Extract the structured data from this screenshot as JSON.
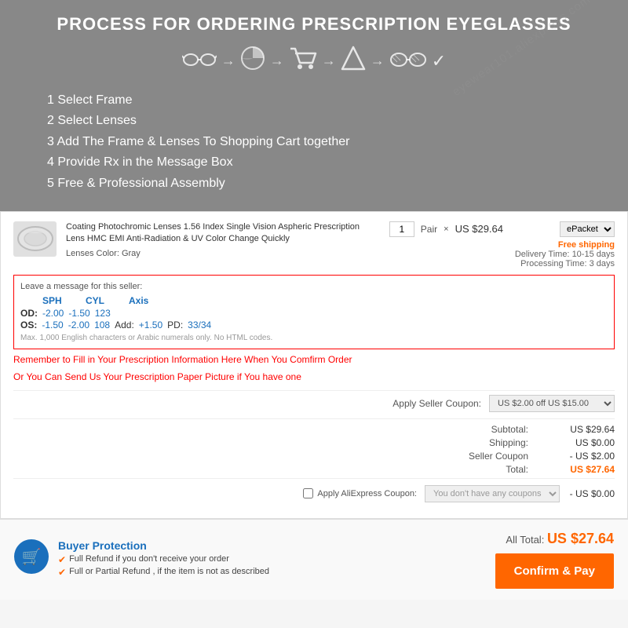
{
  "header": {
    "title": "PROCESS FOR ORDERING PRESCRIPTION EYEGLASSES",
    "watermark": "eyewear101.aliexpress.com"
  },
  "process_icons": {
    "icons": [
      "glasses",
      "lens",
      "cart",
      "warning",
      "rx-glasses"
    ],
    "checkmark": "✓"
  },
  "steps": [
    {
      "number": "1",
      "text": "Select Frame"
    },
    {
      "number": "2",
      "text": "Select Lenses"
    },
    {
      "number": "3",
      "text": "Add The Frame & Lenses To Shopping Cart together"
    },
    {
      "number": "4",
      "text": "Provide Rx in the Message Box"
    },
    {
      "number": "5",
      "text": "Free & Professional Assembly"
    }
  ],
  "product": {
    "title": "Coating Photochromic Lenses 1.56 Index Single Vision Aspheric Prescription Lens HMC EMI Anti-Radiation & UV Color Change Quickly",
    "color_label": "Lenses Color:",
    "color_value": "Gray",
    "quantity": "1",
    "unit": "Pair",
    "unit_price": "US $29.64",
    "shipping_method": "ePacket",
    "free_shipping": "Free shipping",
    "delivery_label": "Delivery Time:",
    "delivery_time": "10-15 days",
    "processing_label": "Processing Time:",
    "processing_time": "3 days"
  },
  "message_box": {
    "label": "Leave a message for this seller:",
    "headers": {
      "sph": "SPH",
      "cyl": "CYL",
      "axis": "Axis"
    },
    "od_row": {
      "eye": "OD:",
      "sph": "-2.00",
      "cyl": "-1.50",
      "axis": "123"
    },
    "os_row": {
      "eye": "OS:",
      "sph": "-1.50",
      "cyl": "-2.00",
      "axis": "108",
      "add_label": "Add:",
      "add_value": "+1.50",
      "pd_label": "PD:",
      "pd_value": "33/34"
    },
    "limit_text": "Max. 1,000 English characters or Arabic numerals only. No HTML codes.",
    "reminder": "Remember to Fill in Your Prescription Information Here When You Comfirm Order",
    "alternative": "Or You Can Send Us Your Prescription Paper Picture if You have one"
  },
  "coupon": {
    "label": "Apply Seller Coupon:",
    "placeholder": "US $2.00 off US $15.00",
    "icon": "▼"
  },
  "totals": {
    "subtotal_label": "Subtotal:",
    "subtotal_value": "US $29.64",
    "shipping_label": "Shipping:",
    "shipping_value": "US $0.00",
    "seller_coupon_label": "Seller Coupon",
    "seller_coupon_value": "- US $2.00",
    "total_label": "Total:",
    "total_value": "US $27.64"
  },
  "aliexpress_coupon": {
    "checkbox_label": "Apply AliExpress Coupon:",
    "placeholder": "You don't have any coupons",
    "discount": "- US $0.00"
  },
  "checkout": {
    "protection_title": "Buyer Protection",
    "protection_items": [
      "Full Refund if you don't receive your order",
      "Full or Partial Refund , if the item is not as described"
    ],
    "all_total_label": "All Total:",
    "all_total_value": "US $27.64",
    "confirm_pay_label": "Confirm & Pay"
  }
}
